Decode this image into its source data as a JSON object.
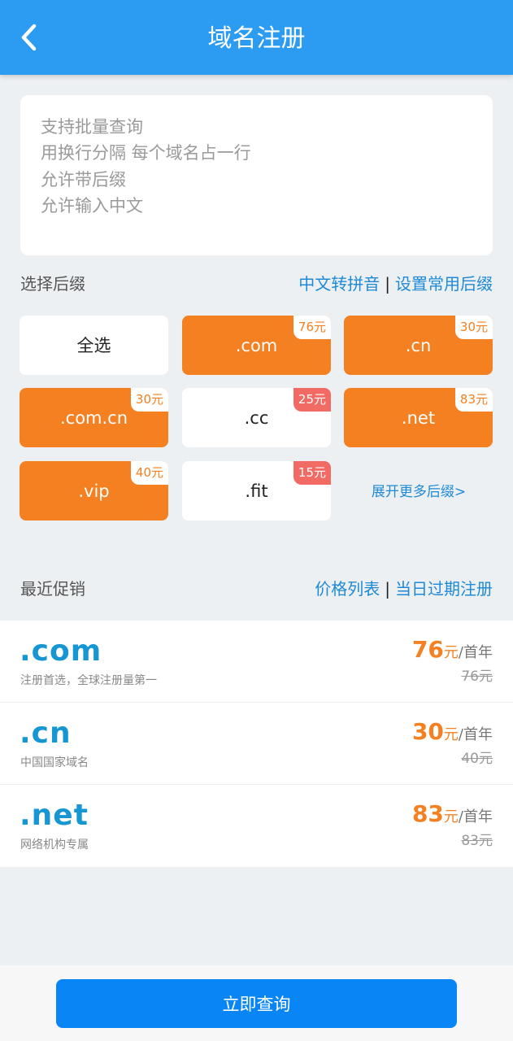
{
  "header": {
    "title": "域名注册"
  },
  "input": {
    "placeholder_lines": [
      "支持批量查询",
      "用换行分隔 每个域名占一行",
      "允许带后缀",
      "允许输入中文"
    ]
  },
  "suffix_section": {
    "label": "选择后缀",
    "link1": "中文转拼音",
    "separator": "|",
    "link2": "设置常用后缀",
    "tiles": [
      {
        "label": "全选",
        "badge": "",
        "selected": false
      },
      {
        "label": ".com",
        "badge": "76元",
        "selected": true
      },
      {
        "label": ".cn",
        "badge": "30元",
        "selected": true
      },
      {
        "label": ".com.cn",
        "badge": "30元",
        "selected": true
      },
      {
        "label": ".cc",
        "badge": "25元",
        "selected": false
      },
      {
        "label": ".net",
        "badge": "83元",
        "selected": true
      },
      {
        "label": ".vip",
        "badge": "40元",
        "selected": true
      },
      {
        "label": ".fit",
        "badge": "15元",
        "selected": false
      }
    ],
    "more_link": "展开更多后缀>"
  },
  "promo_section": {
    "label": "最近促销",
    "link1": "价格列表",
    "separator": "|",
    "link2": "当日过期注册",
    "items": [
      {
        "tld": ".com",
        "desc": "注册首选，全球注册量第一",
        "price": "76",
        "unit": "元",
        "per": "/首年",
        "old_price": "76元"
      },
      {
        "tld": ".cn",
        "desc": "中国国家域名",
        "price": "30",
        "unit": "元",
        "per": "/首年",
        "old_price": "40元"
      },
      {
        "tld": ".net",
        "desc": "网络机构专属",
        "price": "83",
        "unit": "元",
        "per": "/首年",
        "old_price": "83元"
      }
    ]
  },
  "footer": {
    "button_label": "立即查询"
  },
  "colors": {
    "header": "#2b9cf2",
    "accent_orange": "#f48021",
    "link_blue": "#1e8ad6",
    "button_blue": "#0a85f5",
    "badge_red": "#f16a63"
  }
}
